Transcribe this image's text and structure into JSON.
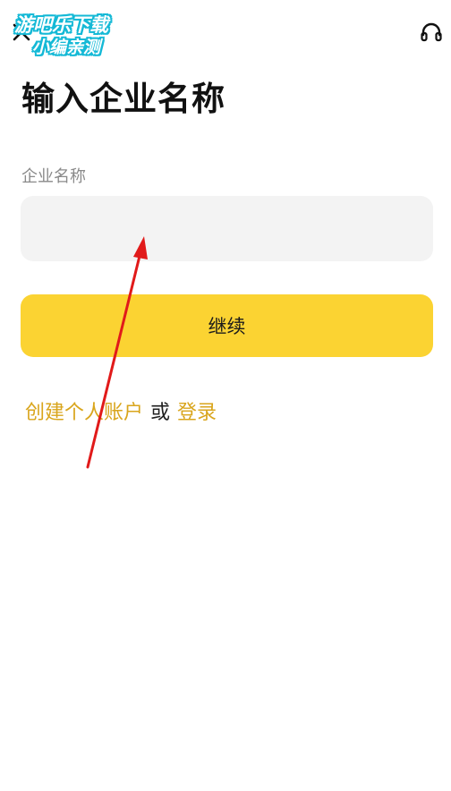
{
  "header": {
    "back_icon": "close-icon",
    "support_icon": "headset-icon",
    "watermark_line1": "游吧乐下载",
    "watermark_line2": "小编亲测"
  },
  "main": {
    "title": "输入企业名称",
    "field_label": "企业名称",
    "input_value": "",
    "input_placeholder": "",
    "continue_label": "继续"
  },
  "footer": {
    "create_account_label": "创建个人账户",
    "or_label": "或",
    "login_label": "登录"
  },
  "colors": {
    "accent": "#fbd332",
    "link": "#d9a51c",
    "annotation": "#e11a1a"
  }
}
